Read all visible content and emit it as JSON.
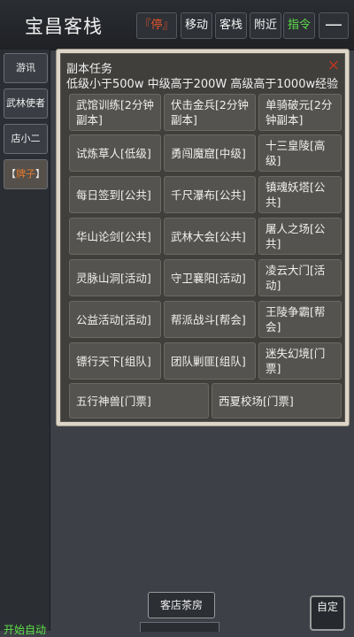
{
  "header": {
    "title": "宝昌客栈",
    "stop_label": "『停』",
    "move_label": "移动",
    "inn_label": "客栈",
    "nearby_label": "附近",
    "command_label": "指令",
    "menu_label": "—"
  },
  "sidebar": {
    "items": [
      {
        "label": "游讯"
      },
      {
        "label": "武林使者"
      },
      {
        "label": "店小二"
      },
      {
        "prefix": "【",
        "hl": "牌子",
        "suffix": "】"
      }
    ]
  },
  "panel": {
    "title": "副本任务",
    "desc": "低级小于500w 中级高于200W 高级高于1000w经验",
    "close_label": "×",
    "tasks": [
      "武馆训练[2分钟副本]",
      "伏击金兵[2分钟副本]",
      "单骑破元[2分钟副本]",
      "试炼草人[低级]",
      "勇闯魔窟[中级]",
      "十三皇陵[高级]",
      "每日签到[公共]",
      "千尺瀑布[公共]",
      "镇魂妖塔[公共]",
      "华山论剑[公共]",
      "武林大会[公共]",
      "屠人之场[公共]",
      "灵脉山洞[活动]",
      "守卫襄阳[活动]",
      "凌云大门[活动]",
      "公益活动[活动]",
      "帮派战斗[帮会]",
      "王陵争霸[帮会]",
      "镖行天下[组队]",
      "团队剿匪[组队]",
      "迷失幻境[门票]",
      "五行神兽[门票]",
      "西夏校场[门票]"
    ]
  },
  "footer": {
    "room_tab": "客店茶房",
    "auto_label": "自定",
    "left_label": "开始自动"
  }
}
